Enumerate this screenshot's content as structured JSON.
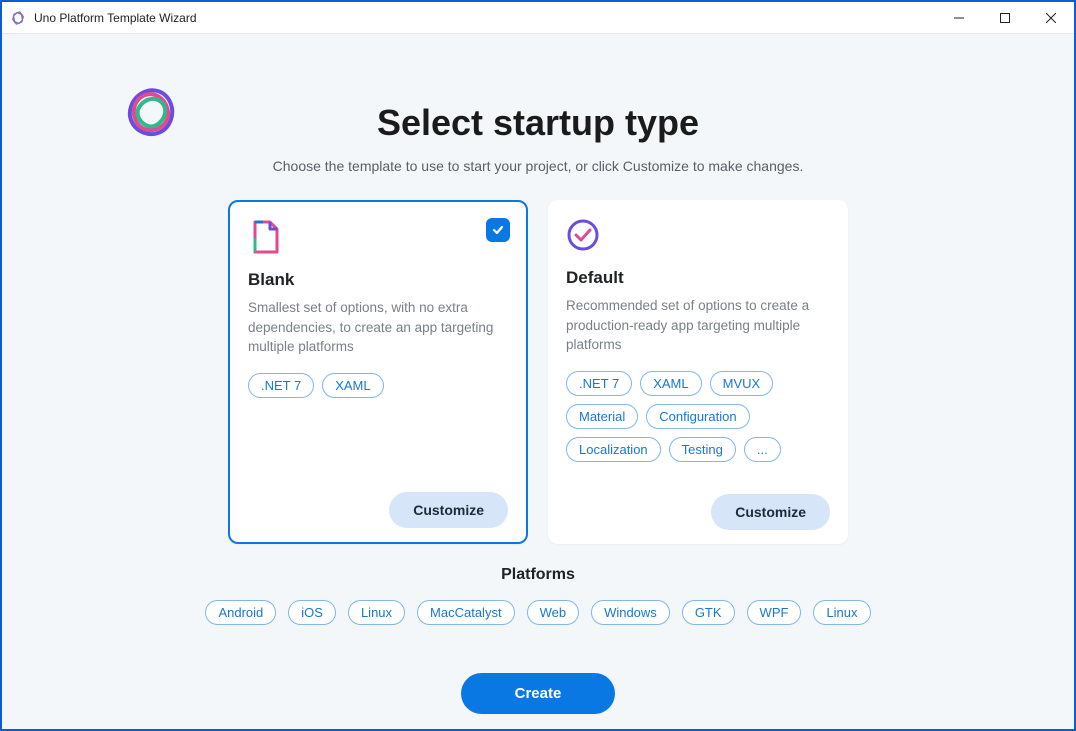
{
  "window": {
    "title": "Uno Platform Template Wizard"
  },
  "header": {
    "title": "Select startup type",
    "subtitle": "Choose the template to use to start your project, or click Customize to make changes."
  },
  "cards": {
    "blank": {
      "title": "Blank",
      "description": "Smallest set of options, with no extra dependencies, to create an app targeting multiple platforms",
      "selected": true,
      "tags": [
        ".NET 7",
        "XAML"
      ],
      "customize_label": "Customize"
    },
    "default": {
      "title": "Default",
      "description": "Recommended set of options to create a production-ready app targeting multiple platforms",
      "selected": false,
      "tags": [
        ".NET 7",
        "XAML",
        "MVUX",
        "Material",
        "Configuration",
        "Localization",
        "Testing",
        "..."
      ],
      "customize_label": "Customize"
    }
  },
  "platforms": {
    "title": "Platforms",
    "items": [
      "Android",
      "iOS",
      "Linux",
      "MacCatalyst",
      "Web",
      "Windows",
      "GTK",
      "WPF",
      "Linux"
    ]
  },
  "actions": {
    "create_label": "Create"
  }
}
